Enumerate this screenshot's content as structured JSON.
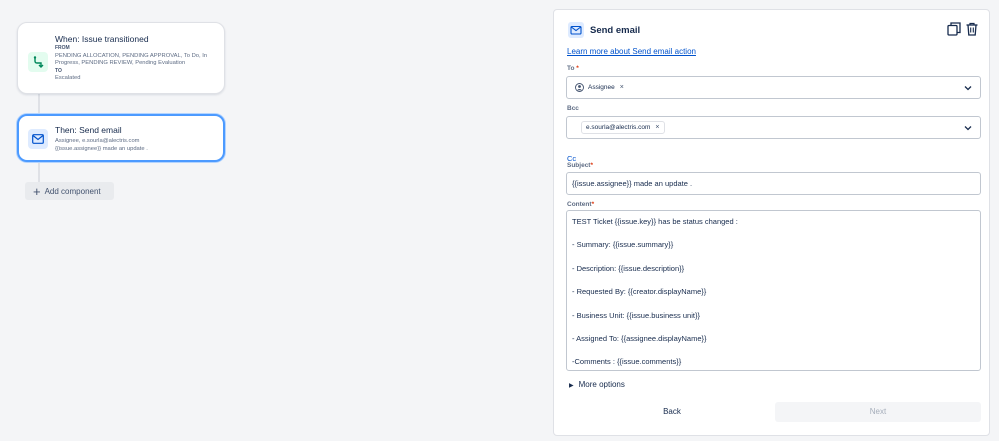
{
  "flow": {
    "trigger": {
      "title": "When: Issue transitioned",
      "from_label": "FROM",
      "from_value_1": "PENDING ALLOCATION, PENDING APPROVAL, To Do, In",
      "from_value_2": "Progress, PENDING REVIEW, Pending Evaluation",
      "to_label": "TO",
      "to_value": "Escalated"
    },
    "action": {
      "title": "Then: Send email",
      "line1": "Assignee, e.sourla@alectris.com",
      "line2": "{{issue.assignee}} made an update ."
    },
    "add_component": "Add component"
  },
  "panel": {
    "title": "Send email",
    "learn_more": "Learn more about Send email action",
    "to": {
      "label": "To",
      "chip": "Assignee"
    },
    "bcc": {
      "label": "Bcc",
      "chip": "e.sourla@alectris.com"
    },
    "cc_link": "Cc",
    "subject": {
      "label": "Subject",
      "value": "{{issue.assignee}} made an update ."
    },
    "content": {
      "label": "Content",
      "lines": [
        "TEST Ticket {{issue.key}} has be status changed :",
        "",
        "- Summary: {{issue.summary}}",
        "",
        "- Description: {{issue.description}}",
        "",
        "- Requested By: {{creator.displayName}}",
        "",
        "- Business Unit: {{issue.business unit}}",
        "",
        "- Assigned To: {{assignee.displayName}}",
        "",
        "-Comments : {{issue.comments}}"
      ]
    },
    "more_options": "More options",
    "back": "Back",
    "next": "Next"
  },
  "colors": {
    "accent": "#0052cc",
    "focus": "#4c9aff",
    "required": "#de350b"
  }
}
